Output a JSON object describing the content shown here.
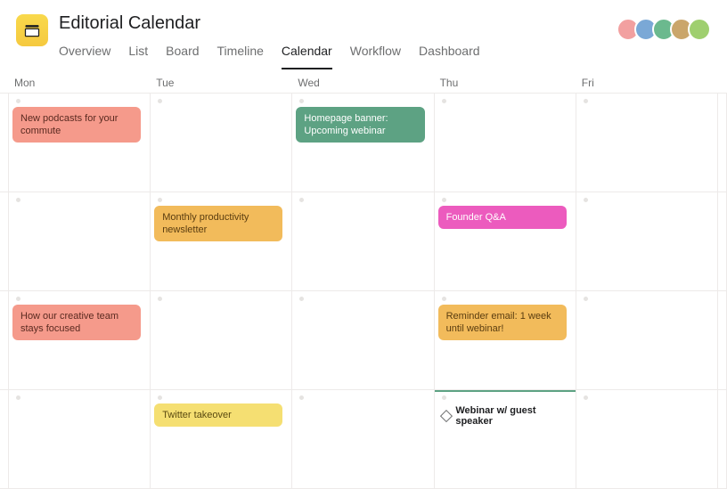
{
  "title": "Editorial Calendar",
  "tabs": [
    {
      "label": "Overview",
      "active": false
    },
    {
      "label": "List",
      "active": false
    },
    {
      "label": "Board",
      "active": false
    },
    {
      "label": "Timeline",
      "active": false
    },
    {
      "label": "Calendar",
      "active": true
    },
    {
      "label": "Workflow",
      "active": false
    },
    {
      "label": "Dashboard",
      "active": false
    }
  ],
  "avatars": [
    {
      "bg": "#f2a0a0"
    },
    {
      "bg": "#7aa8d6"
    },
    {
      "bg": "#6bb98e"
    },
    {
      "bg": "#caa66b"
    },
    {
      "bg": "#9fcf6f"
    }
  ],
  "day_headers": [
    "Mon",
    "Tue",
    "Wed",
    "Thu",
    "Fri"
  ],
  "events": {
    "r0c0": {
      "text": "New podcasts for your commute",
      "color": "salmon"
    },
    "r0c2": {
      "text": "Homepage banner: Upcoming webinar",
      "color": "teal"
    },
    "r1c1": {
      "text": "Monthly productivity newsletter",
      "color": "amber"
    },
    "r1c3": {
      "text": "Founder Q&A",
      "color": "pink"
    },
    "r2c0": {
      "text": "How our creative team stays focused",
      "color": "salmon"
    },
    "r2c3": {
      "text": "Reminder email: 1 week until webinar!",
      "color": "amber"
    },
    "r3c1": {
      "text": "Twitter takeover",
      "color": "yellow"
    },
    "r3c3_milestone": {
      "text": "Webinar w/ guest speaker"
    }
  }
}
